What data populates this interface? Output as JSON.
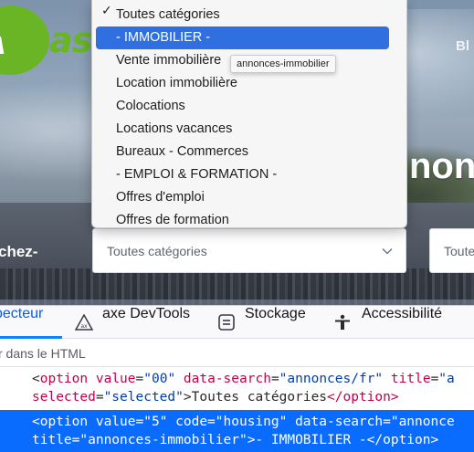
{
  "page": {
    "logo_badge_text": "VA",
    "logo_text": "astre",
    "top_right_text": "Bl",
    "hero_title": "nonce",
    "search_label": "chez-",
    "category_select_value": "Toutes catégories",
    "second_field_value": "Toute"
  },
  "dropdown": {
    "items": [
      {
        "label": "Toutes catégories",
        "checked": true,
        "selected": false
      },
      {
        "label": "- IMMOBILIER -",
        "checked": false,
        "selected": true
      },
      {
        "label": "Vente immobilière",
        "checked": false,
        "selected": false
      },
      {
        "label": "Location immobilière",
        "checked": false,
        "selected": false
      },
      {
        "label": "Colocations",
        "checked": false,
        "selected": false
      },
      {
        "label": "Locations vacances",
        "checked": false,
        "selected": false
      },
      {
        "label": "Bureaux - Commerces",
        "checked": false,
        "selected": false
      },
      {
        "label": "- EMPLOI & FORMATION -",
        "checked": false,
        "selected": false
      },
      {
        "label": "Offres d'emploi",
        "checked": false,
        "selected": false
      },
      {
        "label": "Offres de formation",
        "checked": false,
        "selected": false
      }
    ],
    "check_glyph": "✓",
    "tooltip": "annonces-immobilier"
  },
  "devtools": {
    "tabs": [
      {
        "label": "pecteur",
        "icon": "inspector-icon",
        "active": true
      },
      {
        "label": "axe DevTools",
        "icon": "axe-icon",
        "active": false
      },
      {
        "label": "Stockage",
        "icon": "storage-icon",
        "active": false
      },
      {
        "label": "Accessibilité",
        "icon": "accessibility-icon",
        "active": false
      }
    ],
    "search_text": "r dans le HTML",
    "code": {
      "line1": {
        "open": "<",
        "tag": "option",
        "a1": "value",
        "eq1": "=",
        "v1": "\"00\"",
        "a2": "data-search",
        "eq2": "=",
        "v2": "\"annonces/fr\"",
        "a3": "title",
        "eq3": "=",
        "v3": "\"a"
      },
      "line2": {
        "a1": "selected",
        "eq1": "=",
        "v1": "\"selected\"",
        "close": ">",
        "text": "Toutes catégories",
        "end": "</option>"
      },
      "line3": "<option value=\"5\" code=\"housing\" data-search=\"annonce",
      "line4": "title=\"annonces-immobilier\">- IMMOBILIER -</option>"
    }
  },
  "colors": {
    "brand_green": "#69b526",
    "selection_blue": "#2f6fe0",
    "devtools_accent": "#0a84ff"
  }
}
